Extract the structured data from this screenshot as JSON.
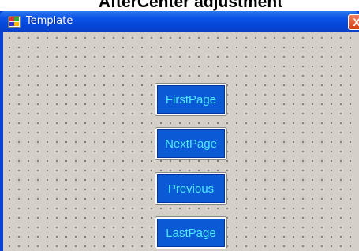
{
  "caption": "AfterCenter adjustment",
  "window": {
    "title": "Template",
    "close_label": "X"
  },
  "buttons": [
    {
      "label": "FirstPage"
    },
    {
      "label": "NextPage"
    },
    {
      "label": "Previous"
    },
    {
      "label": "LastPage"
    }
  ],
  "colors": {
    "titlebar": "#0a52e6",
    "client": "#d4d0c8",
    "button_face": "#0a5ad6",
    "button_text": "#4fe8ff"
  }
}
